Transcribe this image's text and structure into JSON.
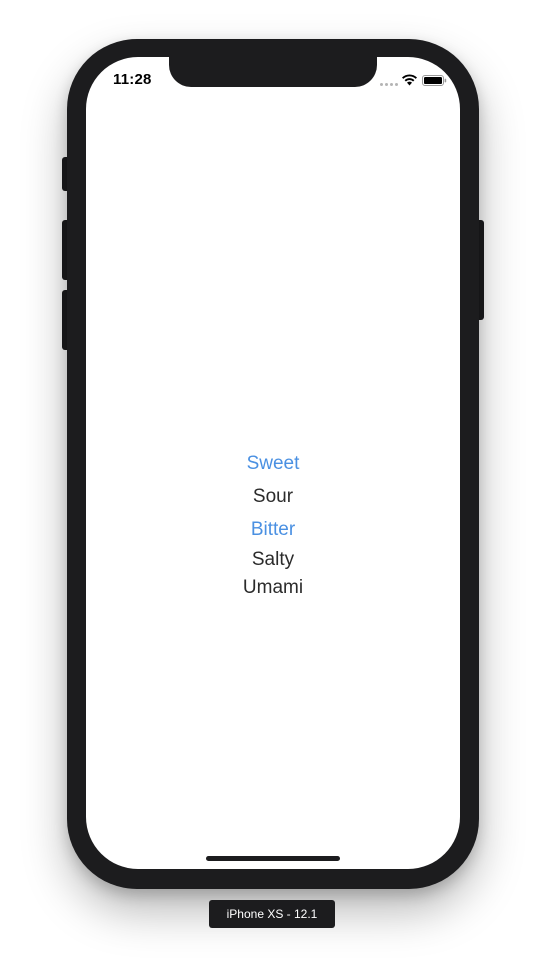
{
  "status_bar": {
    "time": "11:28",
    "icons": [
      "signal-dots-icon",
      "wifi-icon",
      "battery-icon"
    ]
  },
  "tastes": [
    {
      "label": "Sweet",
      "style": "link"
    },
    {
      "label": "Sour",
      "style": "text"
    },
    {
      "label": "Bitter",
      "style": "link"
    },
    {
      "label": "Salty",
      "style": "text"
    },
    {
      "label": "Umami",
      "style": "text"
    }
  ],
  "simulator": {
    "device_label": "iPhone XS - 12.1"
  },
  "colors": {
    "link": "#4a90e2",
    "text": "#2b2b2b",
    "frame": "#1c1c1e"
  }
}
